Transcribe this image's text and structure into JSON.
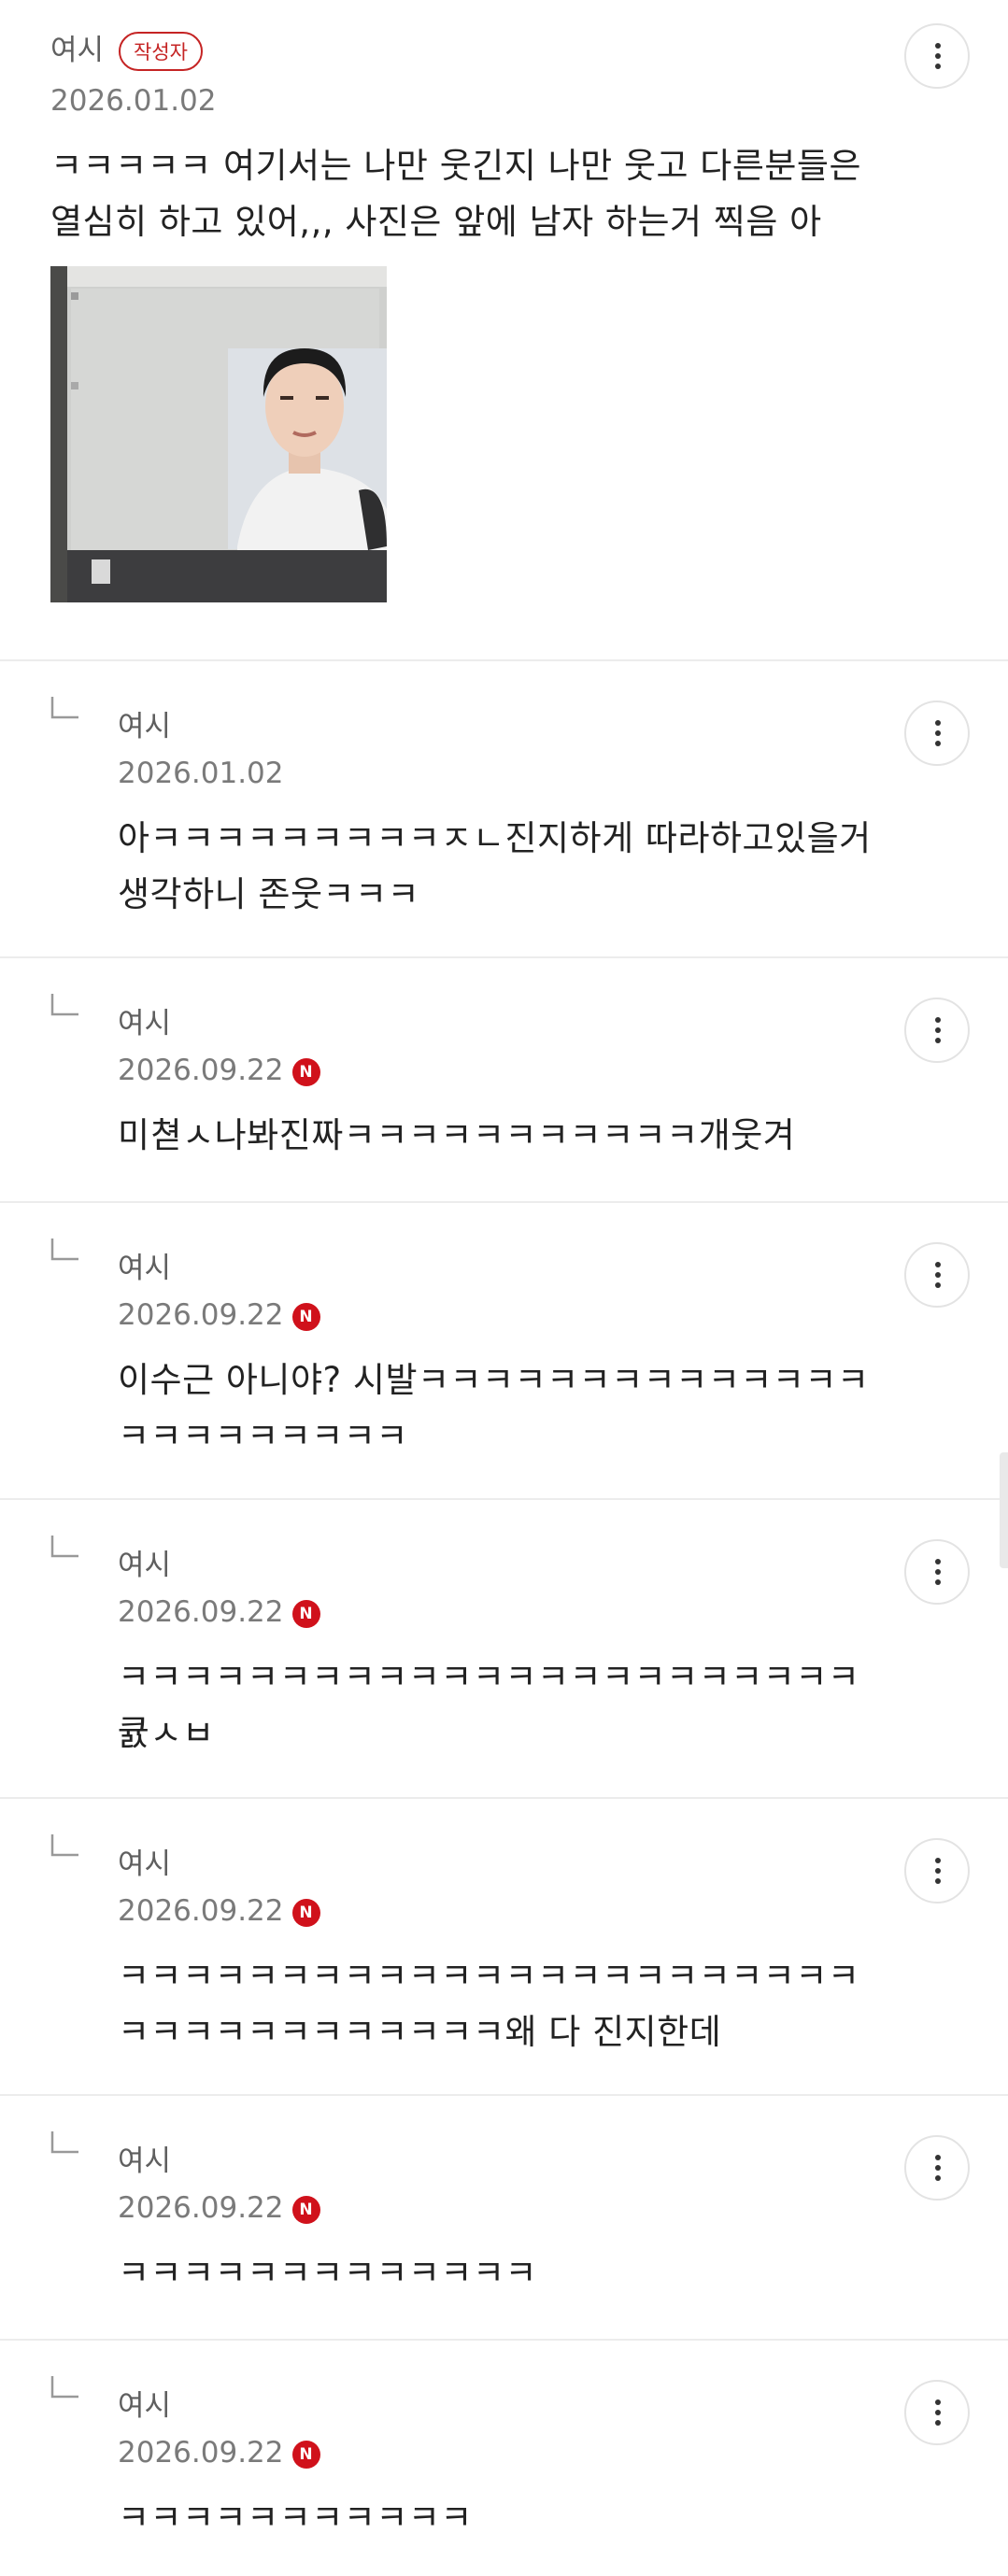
{
  "post_comment": {
    "author": "여시",
    "author_badge": "작성자",
    "date": "2026.01.02",
    "lines": [
      "ㅋㅋㅋㅋㅋ 여기서는 나만 웃긴지 나만 웃고 다른분들은",
      "열심히 하고 있어,,, 사진은 앞에 남자 하는거 찍음 아"
    ]
  },
  "replies": [
    {
      "author": "여시",
      "date": "2026.01.02",
      "is_new": false,
      "lines": [
        "아ㅋㅋㅋㅋㅋㅋㅋㅋㅋㅈㄴ진지하게 따라하고있을거",
        "생각하니 존웃ㅋㅋㅋ"
      ]
    },
    {
      "author": "여시",
      "date": "2026.09.22",
      "is_new": true,
      "new_badge": "N",
      "lines": [
        "미쳗ㅅ나봐진짜ㅋㅋㅋㅋㅋㅋㅋㅋㅋㅋㅋ개웃겨"
      ]
    },
    {
      "author": "여시",
      "date": "2026.09.22",
      "is_new": true,
      "new_badge": "N",
      "lines": [
        "이수근 아니야? 시발ㅋㅋㅋㅋㅋㅋㅋㅋㅋㅋㅋㅋㅋㅋ",
        "ㅋㅋㅋㅋㅋㅋㅋㅋㅋ"
      ]
    },
    {
      "author": "여시",
      "date": "2026.09.22",
      "is_new": true,
      "new_badge": "N",
      "lines": [
        "ㅋㅋㅋㅋㅋㅋㅋㅋㅋㅋㅋㅋㅋㅋㅋㅋㅋㅋㅋㅋㅋㅋㅋ",
        "큜ㅅㅂ"
      ]
    },
    {
      "author": "여시",
      "date": "2026.09.22",
      "is_new": true,
      "new_badge": "N",
      "lines": [
        "ㅋㅋㅋㅋㅋㅋㅋㅋㅋㅋㅋㅋㅋㅋㅋㅋㅋㅋㅋㅋㅋㅋㅋ",
        "ㅋㅋㅋㅋㅋㅋㅋㅋㅋㅋㅋㅋ왜 다 진지한데"
      ]
    },
    {
      "author": "여시",
      "date": "2026.09.22",
      "is_new": true,
      "new_badge": "N",
      "lines": [
        "ㅋㅋㅋㅋㅋㅋㅋㅋㅋㅋㅋㅋㅋ"
      ]
    },
    {
      "author": "여시",
      "date": "2026.09.22",
      "is_new": true,
      "new_badge": "N",
      "lines": [
        "ㅋㅋㅋㅋㅋㅋㅋㅋㅋㅋㅋ"
      ]
    }
  ],
  "icons": {
    "more": "more-vertical-icon",
    "reply": "reply-arrow-icon",
    "new": "new-badge-icon"
  },
  "colors": {
    "badge": "#c52424",
    "new_badge": "#d0111b",
    "divider": "#ececec"
  }
}
